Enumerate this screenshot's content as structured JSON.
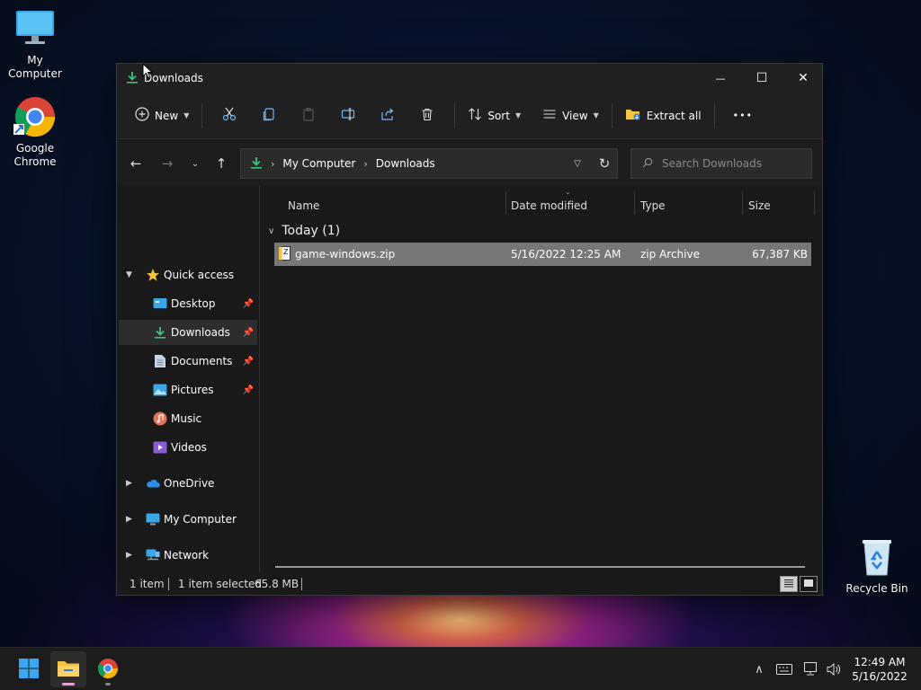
{
  "desktop": {
    "icons": [
      {
        "label": "My Computer"
      },
      {
        "label": "Google\nChrome"
      },
      {
        "label": "Recycle Bin"
      }
    ]
  },
  "window": {
    "title": "Downloads",
    "controls": {
      "minimize": "—",
      "maximize": "☐",
      "close": "✕"
    }
  },
  "toolbar": {
    "new_label": "New",
    "sort_label": "Sort",
    "view_label": "View",
    "extract_label": "Extract all",
    "more_label": "•••"
  },
  "address": {
    "segments": [
      "My Computer",
      "Downloads"
    ],
    "search_placeholder": "Search Downloads"
  },
  "nav": {
    "quick_access": "Quick access",
    "items": [
      {
        "label": "Desktop",
        "pinned": true
      },
      {
        "label": "Downloads",
        "pinned": true,
        "selected": true
      },
      {
        "label": "Documents",
        "pinned": true
      },
      {
        "label": "Pictures",
        "pinned": true
      },
      {
        "label": "Music",
        "pinned": false
      },
      {
        "label": "Videos",
        "pinned": false
      }
    ],
    "roots": [
      {
        "label": "OneDrive"
      },
      {
        "label": "My Computer"
      },
      {
        "label": "Network"
      }
    ]
  },
  "columns": {
    "name": "Name",
    "date": "Date modified",
    "type": "Type",
    "size": "Size"
  },
  "group": {
    "label": "Today (1)"
  },
  "files": [
    {
      "name": "game-windows.zip",
      "date": "5/16/2022 12:25 AM",
      "type": "zip Archive",
      "size": "67,387 KB"
    }
  ],
  "status": {
    "count": "1 item",
    "selected": "1 item selected",
    "size": "65.8 MB"
  },
  "taskbar": {
    "time": "12:49 AM",
    "date": "5/16/2022"
  },
  "colors": {
    "accent_green": "#3fbf7f",
    "folder_yellow": "#f4c542",
    "selection_gray": "#777777"
  }
}
